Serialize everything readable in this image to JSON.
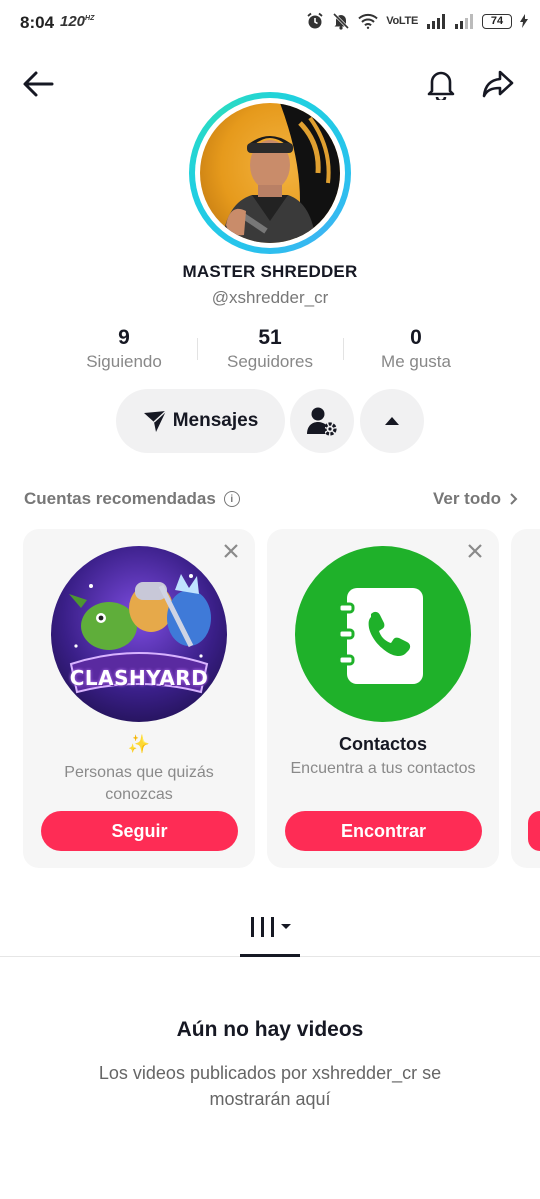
{
  "status_bar": {
    "time": "8:04",
    "refresh_rate": "120",
    "refresh_unit": "HZ",
    "network_label": "VoLTE",
    "battery": "74"
  },
  "header": {
    "back_icon": "arrow-left-icon",
    "bell_icon": "bell-icon",
    "share_icon": "share-icon"
  },
  "profile": {
    "display_name": "MASTER SHREDDER",
    "username": "@xshredder_cr",
    "ring_color": "#27c3ec",
    "stats": [
      {
        "value": "9",
        "label": "Siguiendo"
      },
      {
        "value": "51",
        "label": "Seguidores"
      },
      {
        "value": "0",
        "label": "Me gusta"
      }
    ]
  },
  "actions": {
    "messages_label": "Mensajes",
    "messages_icon": "send-icon",
    "settings_icon": "user-settings-icon",
    "expand_icon": "caret-up-icon"
  },
  "recommended": {
    "title": "Cuentas recomendadas",
    "see_all": "Ver todo",
    "cards": [
      {
        "logo_text": "CLASHYARD",
        "title": "✨",
        "subtitle": "Personas que quizás conozcas",
        "button": "Seguir"
      },
      {
        "title": "Contactos",
        "subtitle": "Encuentra a tus contactos",
        "button": "Encontrar",
        "icon": "contacts-book-icon",
        "icon_bg": "#1fb12a"
      }
    ]
  },
  "tabs": {
    "active_icon": "videos-grid-icon"
  },
  "empty_state": {
    "title": "Aún no hay videos",
    "subtitle": "Los videos publicados por xshredder_cr se mostrarán aquí"
  },
  "colors": {
    "accent": "#fe2c55",
    "text": "#161823",
    "muted": "#888888"
  }
}
